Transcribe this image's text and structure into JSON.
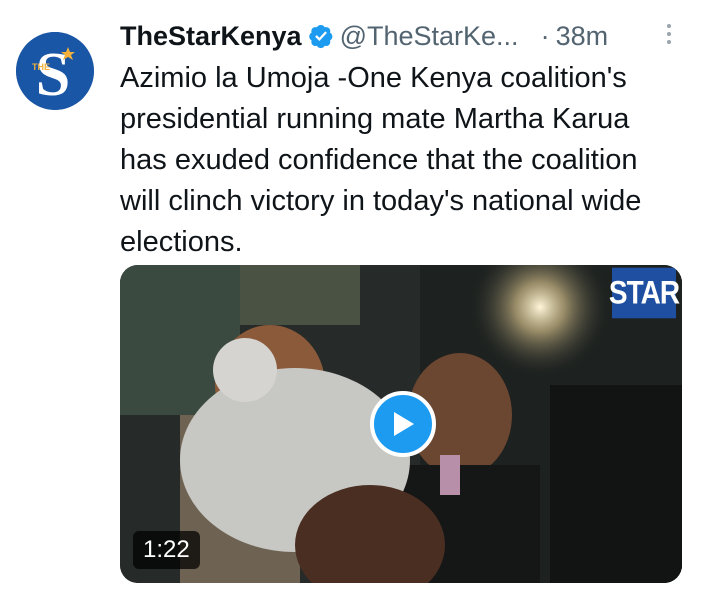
{
  "tweet": {
    "display_name": "TheStarKenya",
    "handle": "@TheStarKe...",
    "separator": "·",
    "time": "38m",
    "avatar": {
      "letter": "S",
      "small_text": "THE",
      "color": "#1a56a6"
    },
    "text": "Azimio la Umoja -One Kenya coalition's\npresidential running mate Martha Karua\nhas exuded confidence that the coalition\nwill clinch victory in today's national wide\nelections.",
    "media": {
      "type": "video",
      "duration": "1:22",
      "watermark": "STAR",
      "play_color": "#1d9bf0"
    }
  },
  "colors": {
    "accent": "#1d9bf0",
    "secondary_text": "#536471",
    "primary_text": "#0f1419"
  }
}
